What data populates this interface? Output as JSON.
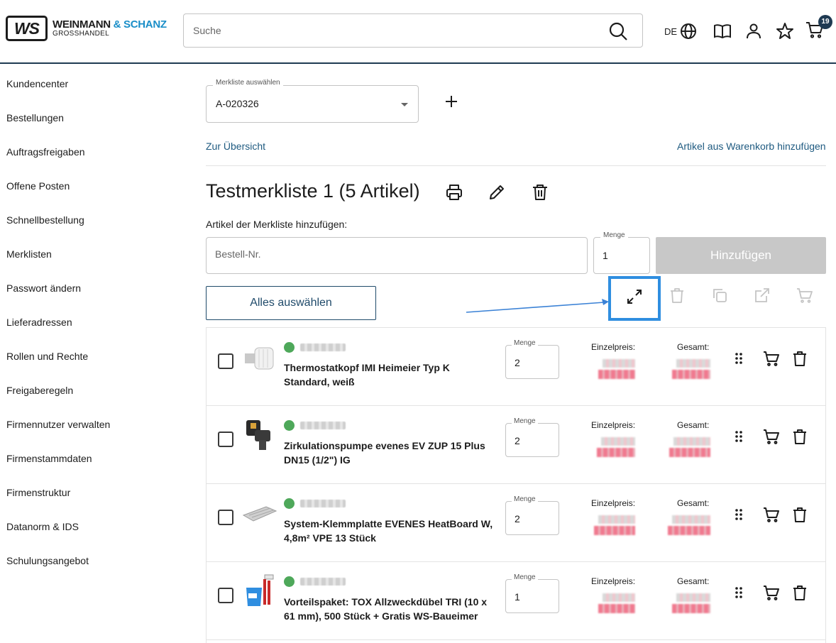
{
  "brand": {
    "logo_mark": "WS",
    "name_part1": "WEINMANN",
    "name_part2": "& SCHANZ",
    "subtitle": "GROSSHANDEL",
    "accent_color": "#1a8ec8",
    "primary_color": "#1f3a52"
  },
  "header": {
    "search_placeholder": "Suche",
    "language": "DE",
    "cart_count": "19",
    "icons": [
      "search-icon",
      "globe-icon",
      "catalog-book-icon",
      "user-icon",
      "favorites-star-icon",
      "cart-icon"
    ]
  },
  "sidebar": {
    "items": [
      {
        "label": "Kundencenter"
      },
      {
        "label": "Bestellungen"
      },
      {
        "label": "Auftragsfreigaben"
      },
      {
        "label": "Offene Posten"
      },
      {
        "label": "Schnellbestellung"
      },
      {
        "label": "Merklisten"
      },
      {
        "label": "Passwort ändern"
      },
      {
        "label": "Lieferadressen"
      },
      {
        "label": "Rollen und Rechte"
      },
      {
        "label": "Freigaberegeln"
      },
      {
        "label": "Firmennutzer verwalten"
      },
      {
        "label": "Firmenstammdaten"
      },
      {
        "label": "Firmenstruktur"
      },
      {
        "label": "Datanorm & IDS"
      },
      {
        "label": "Schulungsangebot"
      }
    ]
  },
  "main": {
    "select_label": "Merkliste auswählen",
    "select_value": "A-020326",
    "overview_link": "Zur Übersicht",
    "add_from_cart_link": "Artikel aus Warenkorb hinzufügen",
    "list_title": "Testmerkliste 1 (5 Artikel)",
    "add_section_label": "Artikel der Merkliste hinzufügen:",
    "order_no_placeholder": "Bestell-Nr.",
    "quantity_label": "Menge",
    "quantity_value": "1",
    "add_button": "Hinzufügen",
    "select_all_button": "Alles auswählen",
    "highlight_color": "#2f8ee0"
  },
  "items_labels": {
    "quantity": "Menge",
    "unit_price": "Einzelpreis:",
    "total": "Gesamt:"
  },
  "items": [
    {
      "name": "Thermostatkopf IMI Heimeier Typ K Standard, weiß",
      "quantity": "2",
      "in_stock": true
    },
    {
      "name": "Zirkulationspumpe evenes EV ZUP 15 Plus DN15 (1/2\") IG",
      "quantity": "2",
      "in_stock": true
    },
    {
      "name": "System-Klemmplatte EVENES HeatBoard W, 4,8m² VPE 13 Stück",
      "quantity": "2",
      "in_stock": true
    },
    {
      "name": "Vorteilspaket: TOX Allzweckdübel TRI (10 x 61 mm), 500 Stück + Gratis WS-Baueimer",
      "quantity": "1",
      "in_stock": true
    }
  ]
}
